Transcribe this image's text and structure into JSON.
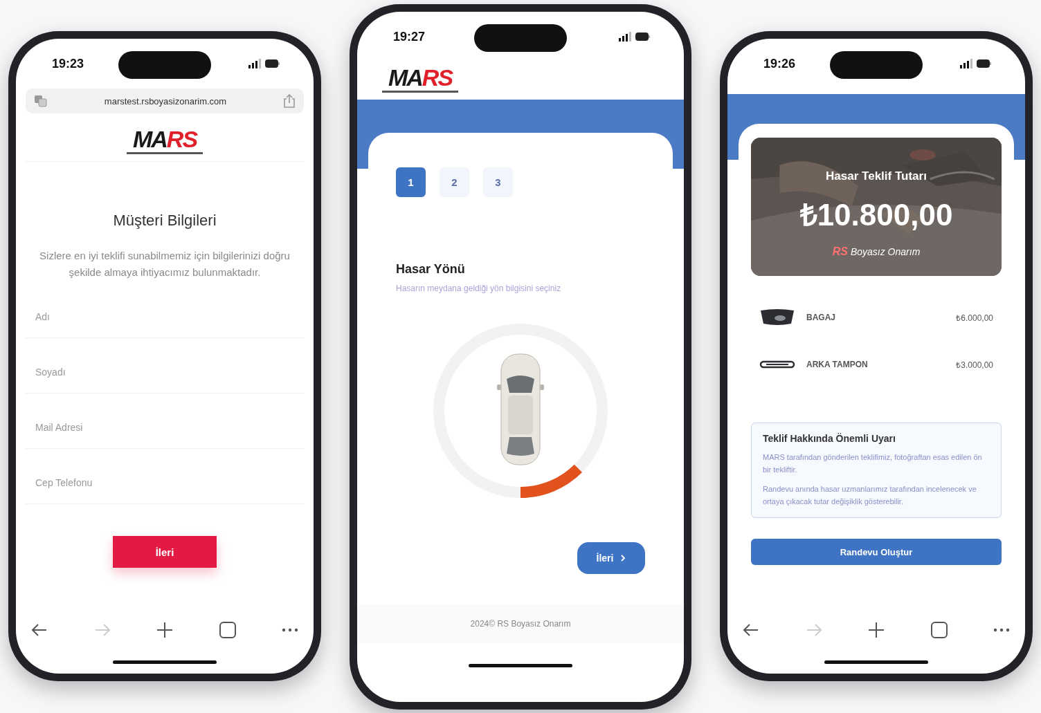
{
  "phones": [
    {
      "kind": "customer-form",
      "status_bar": {
        "time": "19:23"
      },
      "url_bar": {
        "url": "marstest.rsboyasizonarim.com"
      },
      "logo": {
        "dark": "MA",
        "red": "RS"
      },
      "title": "Müşteri Bilgileri",
      "description": "Sizlere en iyi teklifi sunabilmemiz için bilgilerinizi doğru şekilde almaya ihtiyacımız bulunmaktadır.",
      "fields": [
        {
          "placeholder": "Adı"
        },
        {
          "placeholder": "Soyadı"
        },
        {
          "placeholder": "Mail Adresi"
        },
        {
          "placeholder": "Cep Telefonu"
        }
      ],
      "button": "İleri",
      "toolbar": [
        {
          "kind": "back",
          "disabled": false
        },
        {
          "kind": "forward",
          "disabled": true
        },
        {
          "kind": "new-tab",
          "disabled": false
        },
        {
          "kind": "tabs",
          "disabled": false
        },
        {
          "kind": "more",
          "disabled": false
        }
      ]
    },
    {
      "kind": "damage-direction",
      "status_bar": {
        "time": "19:27"
      },
      "logo": {
        "dark": "MA",
        "red": "RS"
      },
      "steps": [
        {
          "label": "1",
          "selected": true
        },
        {
          "label": "2",
          "selected": false
        },
        {
          "label": "3",
          "selected": false
        }
      ],
      "title": "Hasar Yönü",
      "subtitle": "Hasarın meydana geldiği yön bilgisini seçiniz",
      "direction_sectors": [
        {
          "selected": false
        },
        {
          "selected": false
        },
        {
          "selected": false
        },
        {
          "selected": true
        },
        {
          "selected": false
        },
        {
          "selected": false
        },
        {
          "selected": false
        },
        {
          "selected": false
        }
      ],
      "button": "İleri",
      "footer": "2024© RS Boyasız Onarım"
    },
    {
      "kind": "quote",
      "status_bar": {
        "time": "19:26"
      },
      "hero": {
        "kind": "picture",
        "label": "Hasar Teklif Tutarı",
        "amount": "₺10.800,00",
        "brand": {
          "mark": "RS",
          "name": "Boyasız Onarım"
        }
      },
      "items": [
        {
          "kind": "trunk",
          "name": "BAGAJ",
          "price": "₺6.000,00"
        },
        {
          "kind": "bumper",
          "name": "ARKA TAMPON",
          "price": "₺3.000,00"
        }
      ],
      "warning": {
        "title": "Teklif Hakkında Önemli Uyarı",
        "paragraphs": [
          "MARS tarafından gönderilen teklifimiz, fotoğraftan esas edilen ön bir tekliftir.",
          "Randevu anında hasar uzmanlarımız tarafından incelenecek ve ortaya çıkacak tutar değişiklik gösterebilir."
        ]
      },
      "button": "Randevu Oluştur",
      "toolbar": [
        {
          "kind": "back",
          "disabled": false
        },
        {
          "kind": "forward",
          "disabled": true
        },
        {
          "kind": "new-tab",
          "disabled": false
        },
        {
          "kind": "tabs",
          "disabled": false
        },
        {
          "kind": "more",
          "disabled": false
        }
      ]
    }
  ]
}
